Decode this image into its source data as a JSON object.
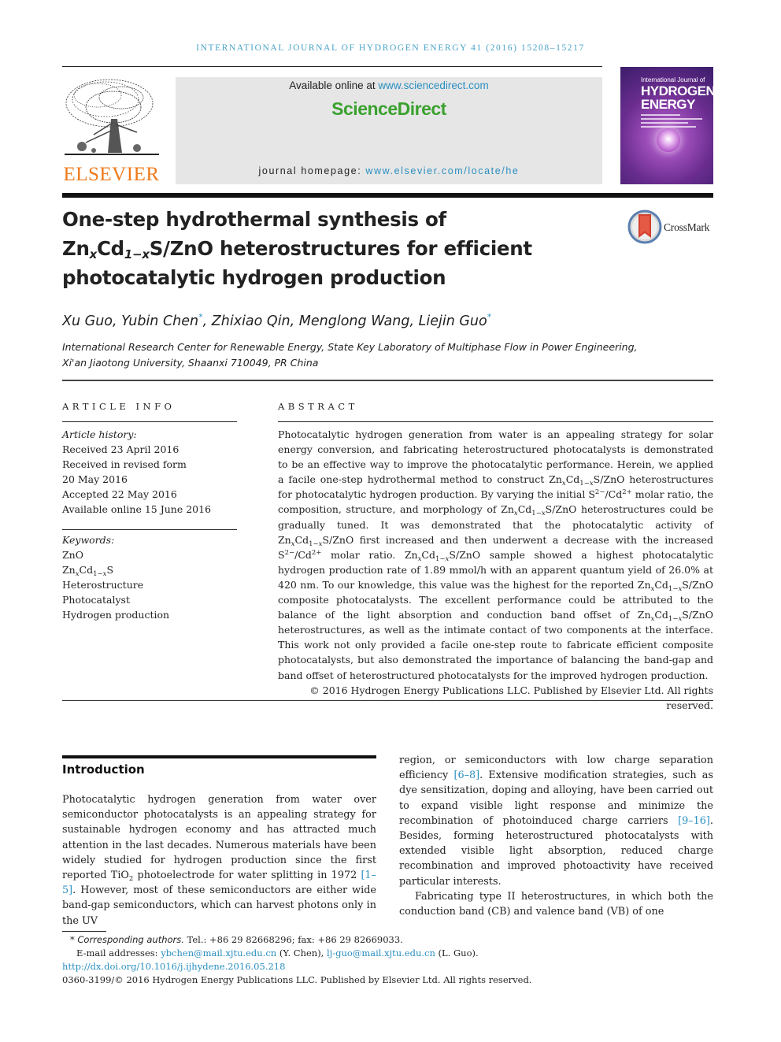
{
  "running_head": "INTERNATIONAL JOURNAL OF HYDROGEN ENERGY 41 (2016) 15208–15217",
  "header": {
    "publisher_logo_text": "ELSEVIER",
    "available_online_prefix": "Available online at ",
    "available_online_link": "www.sciencedirect.com",
    "brand": "ScienceDirect",
    "homepage_prefix": "journal homepage: ",
    "homepage_link": "www.elsevier.com/locate/he",
    "cover": {
      "line1": "International Journal of",
      "line2": "HYDROGEN",
      "line3": "ENERGY"
    },
    "colors": {
      "link": "#2a8fc0",
      "brand_green": "#3aa12e",
      "elsevier_orange": "#f07a1a",
      "running_head": "#4aa3c8"
    }
  },
  "article": {
    "title_line1": "One-step hydrothermal synthesis of",
    "title_line2_pre": "Zn",
    "title_line2_sub1": "x",
    "title_line2_mid": "Cd",
    "title_line2_sub2": "1−x",
    "title_line2_post": "S/ZnO heterostructures for efficient",
    "title_line3": "photocatalytic hydrogen production",
    "crossmark_label": "CrossMark",
    "authors": [
      {
        "name": "Xu Guo",
        "corresponding": false
      },
      {
        "name": "Yubin Chen",
        "corresponding": true
      },
      {
        "name": "Zhixiao Qin",
        "corresponding": false
      },
      {
        "name": "Menglong Wang",
        "corresponding": false
      },
      {
        "name": "Liejin Guo",
        "corresponding": true
      }
    ],
    "affiliation_line1": "International Research Center for Renewable Energy, State Key Laboratory of Multiphase Flow in Power Engineering,",
    "affiliation_line2": "Xi'an Jiaotong University, Shaanxi 710049, PR China"
  },
  "article_info": {
    "label": "ARTICLE INFO",
    "history_heading": "Article history:",
    "history": [
      "Received 23 April 2016",
      "Received in revised form",
      "20 May 2016",
      "Accepted 22 May 2016",
      "Available online 15 June 2016"
    ],
    "keywords_heading": "Keywords:",
    "keywords": [
      "ZnO",
      "ZnxCd1−xS",
      "Heterostructure",
      "Photocatalyst",
      "Hydrogen production"
    ]
  },
  "abstract": {
    "label": "ABSTRACT",
    "p1": "Photocatalytic hydrogen generation from water is an appealing strategy for solar energy conversion, and fabricating heterostructured photocatalysts is demonstrated to be an effective way to improve the photocatalytic performance. Herein, we applied a facile one-step hydrothermal method to construct ",
    "p2": " heterostructures for photocatalytic hydrogen production. By varying the initial ",
    "p3": " molar ratio, the composition, structure, and morphology of ",
    "p4": " heterostructures could be gradually tuned. It was demonstrated that the photocatalytic activity of ",
    "p5": " first increased and then underwent a decrease with the increased ",
    "p6": " molar ratio. ",
    "p7": " sample showed a highest photocatalytic hydrogen production rate of 1.89 mmol/h with an apparent quantum yield of 26.0% at 420 nm. To our knowledge, this value was the highest for the reported ",
    "p8": " composite photocatalysts. The excellent performance could be attributed to the balance of the light absorption and conduction band offset of ",
    "p9": " heterostructures, as well as the intimate contact of two components at the interface. This work not only provided a facile one-step route to fabricate efficient composite photocatalysts, but also demonstrated the importance of balancing the band-gap and band offset of heterostructured photocatalysts for the improved hydrogen production.",
    "formula_post": "S/ZnO",
    "ratio_label": "S2−/Cd2+",
    "copyright": "© 2016 Hydrogen Energy Publications LLC. Published by Elsevier Ltd. All rights reserved."
  },
  "introduction": {
    "heading": "Introduction",
    "left_a": "Photocatalytic hydrogen generation from water over semiconductor photocatalysts is an appealing strategy for sustainable hydrogen economy and has attracted much attention in the last decades. Numerous materials have been widely studied for hydrogen production since the first reported TiO",
    "left_sub": "2",
    "left_b": " photoelectrode for water splitting in 1972 ",
    "ref1": "[1–5]",
    "left_c": ". However, most of these semiconductors are either wide band-gap semiconductors, which can harvest photons only in the UV",
    "right_a": "region, or semiconductors with low charge separation efficiency ",
    "ref2": "[6–8]",
    "right_b": ". Extensive modification strategies, such as dye sensitization, doping and alloying, have been carried out to expand visible light response and minimize the recombination of photoinduced charge carriers ",
    "ref3": "[9–16]",
    "right_c": ". Besides, forming heterostructured photocatalysts with extended visible light absorption, reduced charge recombination and improved photoactivity have received particular interests.",
    "right_p2": "Fabricating type II heterostructures, in which both the conduction band (CB) and valence band (VB) of one"
  },
  "footnotes": {
    "star": "*",
    "corresponding_label": "Corresponding authors.",
    "contact": " Tel.: +86 29 82668296; fax: +86 29 82669033.",
    "email_prefix": "E-mail addresses: ",
    "email1": "ybchen@mail.xjtu.edu.cn",
    "email1_name": " (Y. Chen), ",
    "email2": "lj-guo@mail.xjtu.edu.cn",
    "email2_name": " (L. Guo).",
    "doi": "http://dx.doi.org/10.1016/j.ijhydene.2016.05.218",
    "issn_line": "0360-3199/© 2016 Hydrogen Energy Publications LLC. Published by Elsevier Ltd. All rights reserved."
  }
}
